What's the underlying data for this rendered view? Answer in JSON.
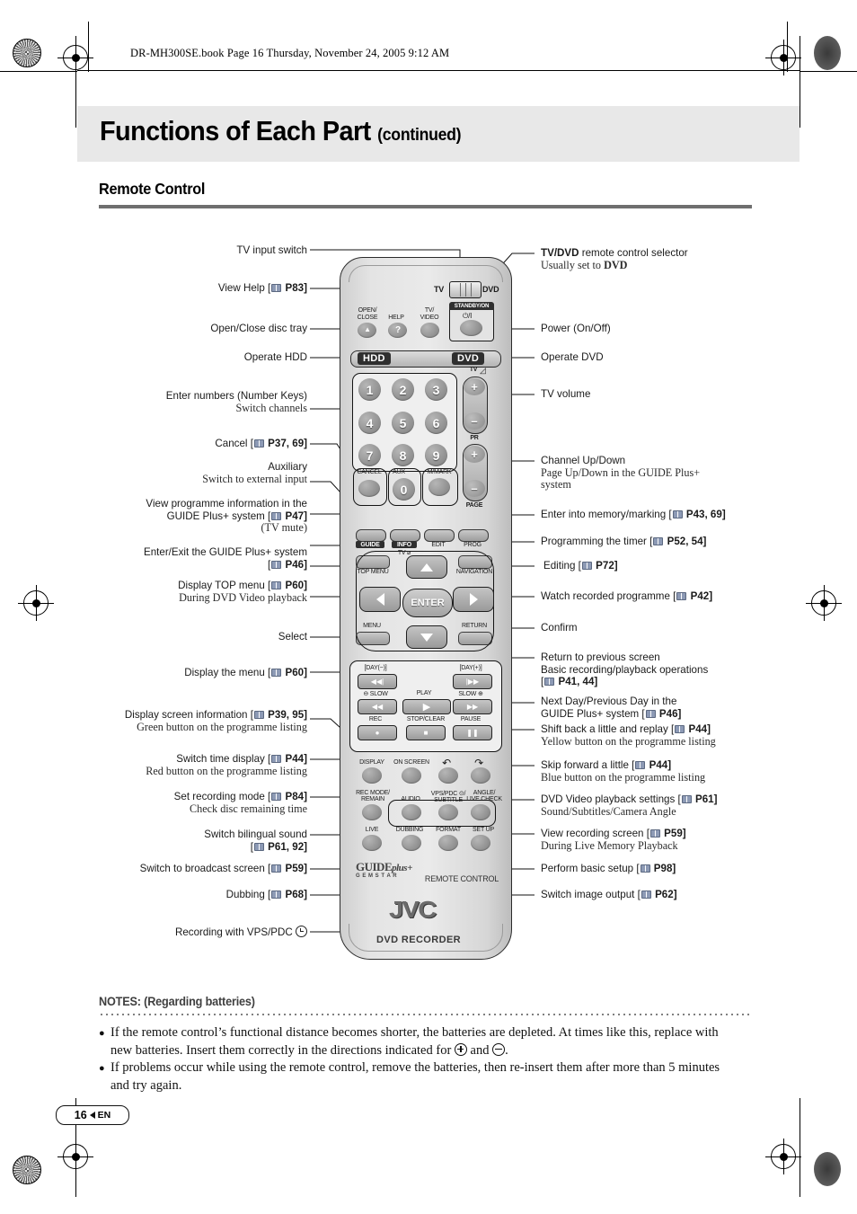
{
  "header": {
    "file_line": "DR-MH300SE.book  Page 16  Thursday, November 24, 2005  9:12 AM"
  },
  "title": {
    "main": "Functions of Each Part ",
    "continued": "(continued)"
  },
  "section": {
    "heading": "Remote Control"
  },
  "labels_left": [
    {
      "id": "tv-input-switch",
      "lines": [
        {
          "t": "TV input switch",
          "s": "n"
        }
      ]
    },
    {
      "id": "view-help",
      "lines": [
        {
          "t": "View Help [",
          "icon": "book",
          "post": " P83]",
          "s": "n"
        }
      ]
    },
    {
      "id": "open-close-disc-tray",
      "lines": [
        {
          "t": "Open/Close disc tray",
          "s": "n"
        }
      ]
    },
    {
      "id": "operate-hdd",
      "lines": [
        {
          "t": "Operate HDD",
          "s": "n"
        }
      ]
    },
    {
      "id": "number-keys",
      "lines": [
        {
          "t": "Enter numbers (Number Keys)",
          "s": "n"
        },
        {
          "t": "Switch channels",
          "s": "ser"
        }
      ]
    },
    {
      "id": "cancel",
      "lines": [
        {
          "t": "Cancel [",
          "icon": "book",
          "post": " P37, 69]",
          "s": "n"
        }
      ]
    },
    {
      "id": "auxiliary",
      "lines": [
        {
          "t": "Auxiliary",
          "s": "n"
        },
        {
          "t": "Switch to external input",
          "s": "ser"
        }
      ]
    },
    {
      "id": "view-programme-info",
      "lines": [
        {
          "t": "View programme information in the",
          "s": "n"
        },
        {
          "t": "GUIDE Plus+ system [",
          "icon": "book",
          "post": " P47]",
          "s": "n"
        },
        {
          "t": "(TV mute)",
          "s": "ser"
        }
      ]
    },
    {
      "id": "enter-exit-guide-plus",
      "lines": [
        {
          "t": "Enter/Exit the GUIDE Plus+ system",
          "s": "n"
        },
        {
          "t": "[",
          "icon": "book",
          "post": " P46]",
          "s": "n"
        }
      ]
    },
    {
      "id": "display-top-menu",
      "lines": [
        {
          "t": "Display TOP menu [",
          "icon": "book",
          "post": " P60]",
          "s": "n"
        },
        {
          "t": "During DVD Video playback",
          "s": "ser"
        }
      ]
    },
    {
      "id": "select",
      "lines": [
        {
          "t": "Select",
          "s": "n"
        }
      ]
    },
    {
      "id": "display-the-menu",
      "lines": [
        {
          "t": "Display the menu [",
          "icon": "book",
          "post": " P60]",
          "s": "n"
        }
      ]
    },
    {
      "id": "display-screen-information",
      "lines": [
        {
          "t": "Display screen information [",
          "icon": "book",
          "post": " P39, 95]",
          "s": "n"
        },
        {
          "t": "Green button on the programme listing",
          "s": "ser"
        }
      ]
    },
    {
      "id": "switch-time-display",
      "lines": [
        {
          "t": "Switch time display [",
          "icon": "book",
          "post": " P44]",
          "s": "n"
        },
        {
          "t": "Red button on the programme listing",
          "s": "ser"
        }
      ]
    },
    {
      "id": "set-recording-mode",
      "lines": [
        {
          "t": "Set recording mode [",
          "icon": "book",
          "post": " P84]",
          "s": "n"
        },
        {
          "t": "Check disc remaining time",
          "s": "ser"
        }
      ]
    },
    {
      "id": "switch-bilingual-sound",
      "lines": [
        {
          "t": "Switch bilingual sound",
          "s": "n"
        },
        {
          "t": "[",
          "icon": "book",
          "post": " P61, 92]",
          "s": "n"
        }
      ]
    },
    {
      "id": "switch-to-broadcast-screen",
      "lines": [
        {
          "t": "Switch to broadcast screen [",
          "icon": "book",
          "post": " P59]",
          "s": "n"
        }
      ]
    },
    {
      "id": "dubbing",
      "lines": [
        {
          "t": "Dubbing [",
          "icon": "book",
          "post": " P68]",
          "s": "n"
        }
      ]
    },
    {
      "id": "recording-with-vps-pdc",
      "lines": [
        {
          "t": "Recording with VPS/PDC ",
          "icon": "clock",
          "post": "",
          "s": "n"
        }
      ]
    }
  ],
  "labels_right": [
    {
      "id": "tv-dvd-selector",
      "lines": [
        {
          "bold": "TV/DVD",
          "t": " remote control selector",
          "s": "n"
        },
        {
          "t": "Usually set to ",
          "bold_post": "DVD",
          "s": "ser"
        }
      ]
    },
    {
      "id": "power-on-off",
      "lines": [
        {
          "t": "Power (On/Off)",
          "s": "n"
        }
      ]
    },
    {
      "id": "operate-dvd",
      "lines": [
        {
          "t": "Operate DVD",
          "s": "n"
        }
      ]
    },
    {
      "id": "tv-volume",
      "lines": [
        {
          "t": "TV volume",
          "s": "n"
        }
      ]
    },
    {
      "id": "channel-up-down",
      "lines": [
        {
          "t": "Channel Up/Down",
          "s": "n"
        },
        {
          "t": "Page Up/Down in the GUIDE Plus+",
          "s": "ser"
        },
        {
          "t": "system",
          "s": "ser"
        }
      ]
    },
    {
      "id": "enter-into-memory-marking",
      "lines": [
        {
          "t": "Enter into memory/marking [",
          "icon": "book",
          "post": " P43, 69]",
          "s": "n"
        }
      ]
    },
    {
      "id": "programming-the-timer",
      "lines": [
        {
          "t": "Programming the timer [",
          "icon": "book",
          "post": " P52, 54]",
          "s": "n"
        }
      ]
    },
    {
      "id": "editing",
      "lines": [
        {
          "t": "Editing [",
          "icon": "book",
          "post": " P72]",
          "s": "n"
        }
      ]
    },
    {
      "id": "watch-recorded-programme",
      "lines": [
        {
          "t": "Watch recorded programme [",
          "icon": "book",
          "post": " P42]",
          "s": "n"
        }
      ]
    },
    {
      "id": "confirm",
      "lines": [
        {
          "t": "Confirm",
          "s": "n"
        }
      ]
    },
    {
      "id": "return-to-previous-screen",
      "lines": [
        {
          "t": "Return to previous screen",
          "s": "n"
        },
        {
          "t": "Basic recording/playback operations",
          "s": "n"
        },
        {
          "t": "[",
          "icon": "book",
          "post": " P41, 44]",
          "s": "n"
        }
      ]
    },
    {
      "id": "next-previous-day",
      "lines": [
        {
          "t": "Next Day/Previous Day in the",
          "s": "n"
        },
        {
          "t": "GUIDE Plus+ system [",
          "icon": "book",
          "post": " P46]",
          "s": "n"
        }
      ]
    },
    {
      "id": "shift-back-replay",
      "lines": [
        {
          "t": "Shift back a little and replay [",
          "icon": "book",
          "post": " P44]",
          "s": "n"
        },
        {
          "t": "Yellow button on the programme listing",
          "s": "ser"
        }
      ]
    },
    {
      "id": "skip-forward-a-little",
      "lines": [
        {
          "t": "Skip forward a little [",
          "icon": "book",
          "post": " P44]",
          "s": "n"
        },
        {
          "t": "Blue button on the programme listing",
          "s": "ser"
        }
      ]
    },
    {
      "id": "dvd-video-playback-settings",
      "lines": [
        {
          "t": "DVD Video playback settings [",
          "icon": "book",
          "post": " P61]",
          "s": "n"
        },
        {
          "t": "Sound/Subtitles/Camera Angle",
          "s": "ser"
        }
      ]
    },
    {
      "id": "view-recording-screen",
      "lines": [
        {
          "t": "View recording screen [",
          "icon": "book",
          "post": " P59]",
          "s": "n"
        },
        {
          "t": "During Live Memory Playback",
          "s": "ser"
        }
      ]
    },
    {
      "id": "perform-basic-setup",
      "lines": [
        {
          "t": "Perform basic setup [",
          "icon": "book",
          "post": " P98]",
          "s": "n"
        }
      ]
    },
    {
      "id": "switch-image-output",
      "lines": [
        {
          "t": "Switch image output [",
          "icon": "book",
          "post": " P62]",
          "s": "n"
        }
      ]
    }
  ],
  "remote": {
    "selector": {
      "left_label": "TV",
      "right_label": "DVD"
    },
    "standby": {
      "header": "STANDBY/ON",
      "symbol": "⏻/I"
    },
    "top_buttons": [
      {
        "caption1": "OPEN/",
        "caption2": "CLOSE",
        "glyph": "▲"
      },
      {
        "caption1": "HELP",
        "caption2": "",
        "glyph": "?"
      },
      {
        "caption1": "TV/",
        "caption2": "VIDEO",
        "glyph": ""
      }
    ],
    "mode_bar": {
      "hdd": "HDD",
      "dvd": "DVD"
    },
    "number_keys": [
      "1",
      "2",
      "3",
      "4",
      "5",
      "6",
      "7",
      "8",
      "9",
      "0"
    ],
    "keypad_captions": {
      "cancel": "CANCEL",
      "aux": "AUX",
      "memory": "M/MARK"
    },
    "volume": {
      "label": "TV",
      "plus": "+",
      "minus": "–"
    },
    "channel": {
      "label": "PR",
      "plus": "+",
      "minus": "–",
      "page": "PAGE"
    },
    "row_guide": [
      {
        "label": "GUIDE",
        "inverse": true
      },
      {
        "label": "INFO",
        "inverse": true,
        "sub": "TV ⌀"
      },
      {
        "label": "EDIT",
        "inverse": false
      },
      {
        "label": "PROG",
        "inverse": false
      }
    ],
    "nav": {
      "top_menu": "TOP MENU",
      "navigation": "NAVIGATION",
      "menu": "MENU",
      "return": "RETURN",
      "enter": "ENTER"
    },
    "playback": {
      "day_minus": "[DAY(−)]",
      "day_plus": "[DAY(+)]",
      "slow_minus": "SLOW",
      "slow_plus": "SLOW",
      "play": "PLAY",
      "rec": "REC",
      "stop_clear": "STOP/CLEAR",
      "pause": "PAUSE"
    },
    "bottom_rows": [
      [
        "DISPLAY",
        "ON SCREEN",
        "↶",
        "↷"
      ],
      [
        "REC MODE/\nREMAIN",
        "AUDIO",
        "VPS/PDC ⊙/\nSUBTITLE",
        "ANGLE/\nLIVE CHECK"
      ],
      [
        "LIVE",
        "DUBBING",
        "FORMAT",
        "SET UP"
      ]
    ],
    "branding": {
      "guide_plus": "GUIDE",
      "guide_plus_suffix": "plus+",
      "gemstar": "G E M S T A R",
      "remote_control": "REMOTE CONTROL",
      "brand": "JVC",
      "product": "DVD RECORDER"
    }
  },
  "notes": {
    "heading": "NOTES: (Regarding batteries)",
    "items": [
      "If the remote control’s functional distance becomes shorter, the batteries are depleted. At times like this, replace with new batteries. Insert them correctly in the directions indicated for ",
      "If problems occur while using the remote control, remove the batteries, then re-insert them after more than 5 minutes and try again."
    ],
    "item1_mid": " and ",
    "item1_end": "."
  },
  "footer": {
    "page": "16",
    "lang": "EN"
  }
}
